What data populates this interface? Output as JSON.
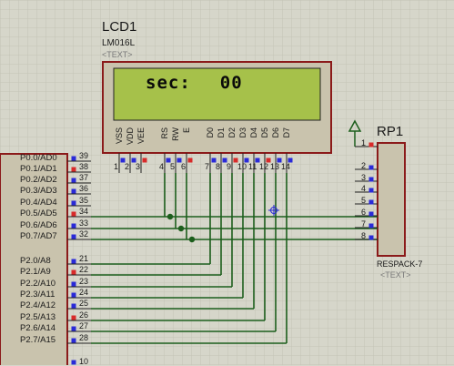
{
  "lcd": {
    "name": "LCD1",
    "model": "LM016L",
    "text_placeholder": "<TEXT>",
    "display_label": "sec:",
    "display_value": "00",
    "pins": [
      {
        "label": "VSS",
        "num": "1"
      },
      {
        "label": "VDD",
        "num": "2"
      },
      {
        "label": "VEE",
        "num": "3"
      },
      {
        "label": "RS",
        "num": "4"
      },
      {
        "label": "RW",
        "num": "5"
      },
      {
        "label": "E",
        "num": "6"
      },
      {
        "label": "D0",
        "num": "7"
      },
      {
        "label": "D1",
        "num": "8"
      },
      {
        "label": "D2",
        "num": "9"
      },
      {
        "label": "D3",
        "num": "10"
      },
      {
        "label": "D4",
        "num": "11"
      },
      {
        "label": "D5",
        "num": "12"
      },
      {
        "label": "D6",
        "num": "13"
      },
      {
        "label": "D7",
        "num": "14"
      }
    ]
  },
  "mcu": {
    "port0": [
      {
        "label": "P0.0/AD0",
        "num": "39"
      },
      {
        "label": "P0.1/AD1",
        "num": "38"
      },
      {
        "label": "P0.2/AD2",
        "num": "37"
      },
      {
        "label": "P0.3/AD3",
        "num": "36"
      },
      {
        "label": "P0.4/AD4",
        "num": "35"
      },
      {
        "label": "P0.5/AD5",
        "num": "34"
      },
      {
        "label": "P0.6/AD6",
        "num": "33"
      },
      {
        "label": "P0.7/AD7",
        "num": "32"
      }
    ],
    "port2": [
      {
        "label": "P2.0/A8",
        "num": "21"
      },
      {
        "label": "P2.1/A9",
        "num": "22"
      },
      {
        "label": "P2.2/A10",
        "num": "23"
      },
      {
        "label": "P2.3/A11",
        "num": "24"
      },
      {
        "label": "P2.4/A12",
        "num": "25"
      },
      {
        "label": "P2.5/A13",
        "num": "26"
      },
      {
        "label": "P2.6/A14",
        "num": "27"
      },
      {
        "label": "P2.7/A15",
        "num": "28"
      }
    ],
    "extra_pin": "10"
  },
  "rp": {
    "name": "RP1",
    "model": "RESPACK-7",
    "text_placeholder": "<TEXT>",
    "pins": [
      "1",
      "2",
      "3",
      "4",
      "5",
      "6",
      "7",
      "8"
    ]
  },
  "colors": {
    "background": "#d6d6ca",
    "component_body": "#c9c3ad",
    "component_border": "#8b1a1a",
    "lcd_screen": "#a6c14a",
    "wire": "#1c5e1c",
    "pin_blue": "#2a2ad8",
    "pin_red": "#d82a2a"
  }
}
